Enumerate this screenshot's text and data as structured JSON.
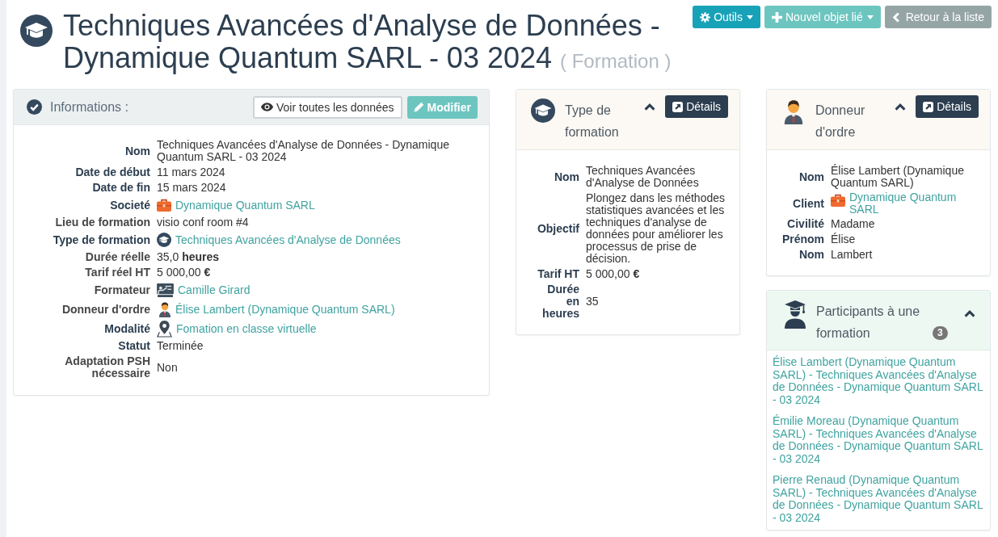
{
  "page": {
    "title": "Techniques Avancées d'Analyse de Données - Dynamique Quantum SARL - 03 2024",
    "record_type": "( Formation )"
  },
  "actions": [
    {
      "kind": "tools",
      "label": "Outils",
      "dropdown": true
    },
    {
      "kind": "create",
      "label": "Nouvel objet lié",
      "dropdown": true
    },
    {
      "kind": "back",
      "label": "Retour à la liste",
      "dropdown": false
    }
  ],
  "information": {
    "title": "Informations :",
    "buttons": [
      {
        "kind": "view",
        "label": "Voir toutes les données"
      },
      {
        "kind": "edit",
        "label": "Modifier"
      }
    ],
    "fields": [
      {
        "label": "Nom",
        "required": true,
        "kind": "text",
        "value": "Techniques Avancées d'Analyse de Données - Dynamique Quantum SARL - 03 2024"
      },
      {
        "label": "Date de début",
        "required": true,
        "kind": "text",
        "value": "11 mars 2024"
      },
      {
        "label": "Date de fin",
        "required": true,
        "kind": "text",
        "value": "15 mars 2024"
      },
      {
        "label": "Societé",
        "required": true,
        "kind": "company",
        "value": "Dynamique Quantum SARL"
      },
      {
        "label": "Lieu de formation",
        "required": false,
        "kind": "text",
        "value": "visio conf room #4"
      },
      {
        "label": "Type de formation",
        "required": true,
        "kind": "training",
        "value": "Techniques Avancées d'Analyse de Données"
      },
      {
        "label": "Durée réelle",
        "required": false,
        "kind": "text",
        "value": "35,0 **heures**"
      },
      {
        "label": "Tarif réel HT",
        "required": false,
        "kind": "text",
        "value": "5 000,00 **€**"
      },
      {
        "label": "Formateur",
        "required": false,
        "kind": "trainer",
        "value": "Camille Girard"
      },
      {
        "label": "Donneur d'ordre",
        "required": false,
        "kind": "person",
        "value": "Élise Lambert (Dynamique Quantum SARL)"
      },
      {
        "label": "Modalité",
        "required": true,
        "kind": "location",
        "value": "Fomation en classe virtuelle"
      },
      {
        "label": "Statut",
        "required": true,
        "kind": "text",
        "value": "Terminée"
      },
      {
        "label": "Adaptation PSH nécessaire",
        "required": false,
        "kind": "text",
        "value": "Non"
      }
    ]
  },
  "middle_panels": [
    {
      "kind": "training",
      "title": "Type de formation",
      "expanded": true,
      "button": "Détails",
      "fields": [
        {
          "label": "Nom",
          "kind": "text",
          "value": "Techniques Avancées d'Analyse de Données"
        },
        {
          "label": "Objectif",
          "kind": "text",
          "value": "Plongez dans les méthodes statistiques avancées et les techniques d'analyse de données pour améliorer les processus de prise de décision."
        },
        {
          "label": "Tarif HT",
          "kind": "text",
          "value": "5 000,00 **€**"
        },
        {
          "label": "Durée en heures",
          "kind": "text",
          "value": "35"
        }
      ]
    }
  ],
  "right_panels": [
    {
      "kind": "person",
      "title": "Donneur d'ordre",
      "expanded": true,
      "button": "Détails",
      "fields": [
        {
          "label": "Nom",
          "kind": "text",
          "value": "Élise Lambert (Dynamique Quantum SARL)"
        },
        {
          "label": "Client",
          "kind": "company",
          "value": "Dynamique Quantum SARL"
        },
        {
          "label": "Civilité",
          "kind": "text",
          "value": "Madame"
        },
        {
          "label": "Prénom",
          "kind": "text",
          "value": "Élise"
        },
        {
          "label": "Nom",
          "kind": "text",
          "value": "Lambert"
        }
      ]
    },
    {
      "kind": "participants",
      "title": "Participants à une formation",
      "count": "3",
      "expanded": true,
      "items": [
        "Élise Lambert (Dynamique Quantum SARL) - Techniques Avancées d'Analyse de Données - Dynamique Quantum SARL - 03 2024",
        "Émilie Moreau (Dynamique Quantum SARL) - Techniques Avancées d'Analyse de Données - Dynamique Quantum SARL - 03 2024",
        "Pierre Renaud (Dynamique Quantum SARL) - Techniques Avancées d'Analyse de Données - Dynamique Quantum SARL - 03 2024"
      ]
    }
  ]
}
